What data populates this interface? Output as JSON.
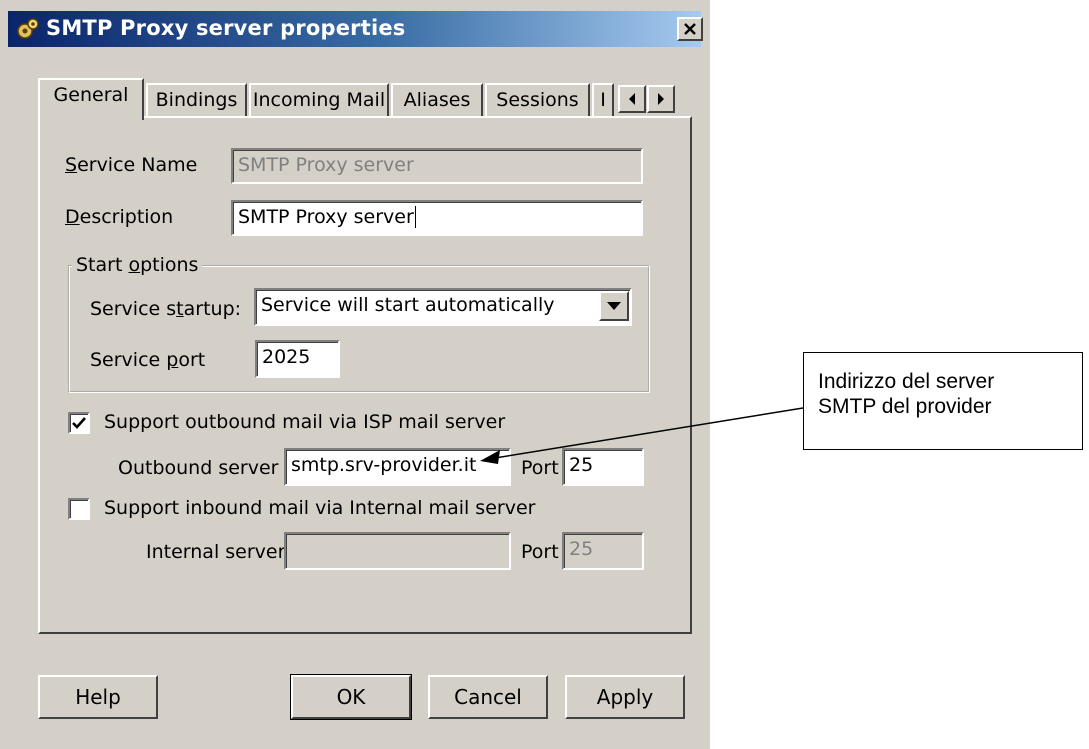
{
  "window": {
    "title": "SMTP Proxy server properties"
  },
  "tabs": [
    "General",
    "Bindings",
    "Incoming Mail",
    "Aliases",
    "Sessions",
    "I"
  ],
  "general": {
    "service_name_label": "Service Name",
    "service_name_accel": "S",
    "service_name_rest": "ervice Name",
    "service_name_value": "SMTP Proxy server",
    "description_accel": "D",
    "description_rest": "escription",
    "description_value": "SMTP Proxy server",
    "start_options_pre": "Start ",
    "start_options_accel": "o",
    "start_options_rest": "ptions",
    "startup_pre": "Service s",
    "startup_accel": "t",
    "startup_rest": "artup:",
    "startup_value": "Service will start automatically",
    "port_pre": "Service ",
    "port_accel": "p",
    "port_rest": "ort",
    "port_value": "2025",
    "outbound_check_label": "Support outbound mail via ISP mail server",
    "outbound_checked": true,
    "outbound_server_label": "Outbound server",
    "outbound_server_value": "smtp.srv-provider.it",
    "outbound_port_label": "Port",
    "outbound_port_value": "25",
    "inbound_check_label": "Support inbound mail via Internal mail server",
    "inbound_checked": false,
    "internal_server_label": "Internal server",
    "internal_server_value": "",
    "internal_port_label": "Port",
    "internal_port_value": "25"
  },
  "buttons": {
    "help": "Help",
    "ok": "OK",
    "cancel": "Cancel",
    "apply": "Apply"
  },
  "callout": {
    "line1": "Indirizzo del server",
    "line2": "SMTP del provider"
  },
  "colors": {
    "title_start": "#0a246a",
    "title_end": "#a6caf0",
    "face": "#d4d0c8"
  },
  "icons": [
    "gear-icon",
    "close-icon",
    "tab-scroll-left-icon",
    "tab-scroll-right-icon",
    "dropdown-arrow-icon",
    "checkmark-icon"
  ]
}
